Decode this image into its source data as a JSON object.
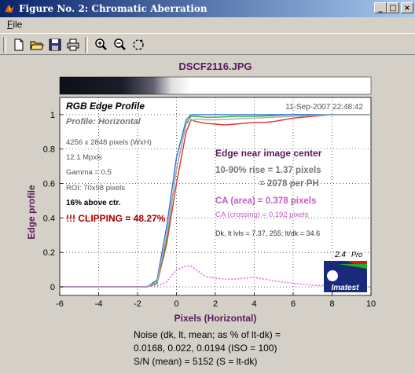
{
  "window": {
    "title": "Figure No. 2: Chromatic Aberration",
    "min_label": "_",
    "max_label": "□",
    "close_label": "×"
  },
  "menu": {
    "file_label_first": "F",
    "file_label_rest": "ile"
  },
  "toolbar": {
    "icons": [
      "new-file-icon",
      "open-folder-icon",
      "save-icon",
      "print-icon",
      "zoom-in-icon",
      "zoom-out-icon",
      "rotate-icon"
    ]
  },
  "figure": {
    "filename": "DSCF2116.JPG",
    "chart_title": "RGB Edge Profile",
    "profile_label": "Profile: Horizontal",
    "timestamp": "11-Sep-2007 22:48:42",
    "info_lines": [
      "4256 x 2848 pixels (WxH)",
      "12.1 Mpxls",
      "Gamma = 0.5",
      "ROI: 70x98 pixels"
    ],
    "above_ctr": "16% above ctr.",
    "clipping": "!!! CLIPPING =  48.27%",
    "edge_heading": "Edge near image center",
    "rise_line1": "10-90% rise = 1.37 pixels",
    "rise_line2": "= 2078 per PH",
    "ca_area": "CA (area) = 0.378 pixels",
    "ca_crossing": "CA (crossing) = 0.192 pixels",
    "levels": "Dk, lt lvls = 7.37, 255;  lt/dk = 34.6",
    "version": "2.4",
    "version_suffix": "Pro",
    "brand": "Imatest",
    "noise_line1": "Noise (dk, lt, mean; as % of lt-dk) =",
    "noise_line2": "0.0168,  0.022,  0.0194  (ISO =   100)",
    "noise_line3": "S/N (mean) = 5152  (S = lt-dk)",
    "colors": {
      "title": "#5a1a5a",
      "red": "#aa0000",
      "ca": "#c060c0",
      "gray": "#777777"
    }
  },
  "chart_data": {
    "type": "line",
    "xlabel": "Pixels (Horizontal)",
    "ylabel": "Edge profile",
    "xlim": [
      -6,
      10
    ],
    "ylim": [
      -0.05,
      1.1
    ],
    "xticks": [
      -6,
      -4,
      -2,
      0,
      2,
      4,
      6,
      8,
      10
    ],
    "yticks": [
      0,
      0.2,
      0.4,
      0.6,
      0.8,
      1
    ],
    "ytick_labels": [
      "0",
      "0.2",
      "0.4",
      "0.6",
      "0.8",
      "1"
    ],
    "grid": true,
    "series": [
      {
        "color": "#e03030",
        "x": [
          -6,
          -2,
          -1.5,
          -1,
          -0.5,
          0,
          0.5,
          0.75,
          1,
          1.5,
          2,
          2.5,
          3,
          3.5,
          4,
          4.5,
          5,
          6,
          7,
          8,
          10
        ],
        "y": [
          0,
          0,
          0,
          0.02,
          0.25,
          0.6,
          0.9,
          0.97,
          0.96,
          0.95,
          0.945,
          0.94,
          0.945,
          0.95,
          0.955,
          0.955,
          0.96,
          0.98,
          0.99,
          1,
          1
        ]
      },
      {
        "color": "#30b030",
        "x": [
          -6,
          -2,
          -1.5,
          -1,
          -0.5,
          0,
          0.5,
          0.75,
          1,
          1.5,
          2,
          3,
          4,
          5,
          6,
          7,
          8,
          10
        ],
        "y": [
          0,
          0,
          0,
          0.02,
          0.28,
          0.68,
          0.95,
          0.99,
          0.99,
          0.985,
          0.985,
          0.99,
          0.99,
          0.995,
          1,
          1,
          1,
          1
        ]
      },
      {
        "color": "#3070e0",
        "x": [
          -6,
          -2,
          -1.5,
          -1,
          -0.5,
          0,
          0.5,
          0.75,
          1,
          1.5,
          2,
          3,
          4,
          5,
          6,
          7,
          8,
          10
        ],
        "y": [
          0,
          0,
          0,
          0.04,
          0.35,
          0.75,
          0.97,
          1,
          1,
          1,
          1,
          1,
          1,
          1,
          1,
          1,
          1,
          1
        ]
      },
      {
        "color": "#aaaaaa",
        "x": [
          -6,
          -2,
          -1.5,
          -1,
          -0.5,
          0,
          0.5,
          1,
          1.5,
          2,
          3,
          4,
          5,
          6,
          7,
          8,
          10
        ],
        "y": [
          0,
          0,
          0,
          0.03,
          0.3,
          0.68,
          0.95,
          0.975,
          0.97,
          0.97,
          0.975,
          0.98,
          0.985,
          0.99,
          0.995,
          1,
          1
        ]
      },
      {
        "color": "#e070e0",
        "dashed": true,
        "x": [
          -6,
          -2,
          -1.5,
          -1,
          -0.5,
          0,
          0.5,
          0.75,
          1,
          1.5,
          2,
          2.5,
          3,
          3.5,
          4,
          4.5,
          5,
          6,
          7,
          8,
          9,
          10
        ],
        "y": [
          0,
          0,
          0,
          0.005,
          0.03,
          0.1,
          0.12,
          0.12,
          0.1,
          0.06,
          0.05,
          0.045,
          0.045,
          0.05,
          0.055,
          0.045,
          0.035,
          0.02,
          0.01,
          0.005,
          0,
          0
        ]
      }
    ]
  }
}
